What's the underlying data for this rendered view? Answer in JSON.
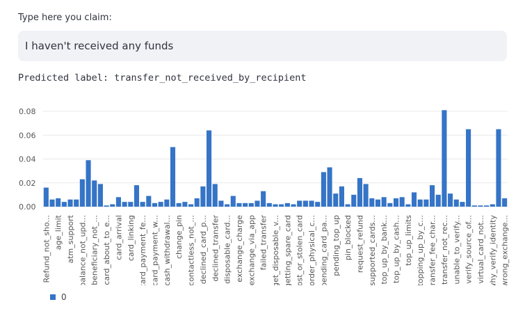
{
  "claim": {
    "label": "Type here you claim:",
    "value": "I haven't received any funds"
  },
  "prediction": {
    "text": "Predicted label: transfer_not_received_by_recipient"
  },
  "colors": {
    "bar": "#3574c6",
    "input_bg": "#f0f2f6",
    "grid": "#e8e8e8"
  },
  "chart_data": {
    "type": "bar",
    "ylim": [
      0,
      0.082
    ],
    "yticks": [
      "0.00",
      "0.02",
      "0.04",
      "0.06",
      "0.08"
    ],
    "ytick_values": [
      0,
      0.02,
      0.04,
      0.06,
      0.08
    ],
    "tick_labels": [
      "Refund_not_sho...",
      "age_limit",
      "atm_support",
      "balance_not_upd...",
      "beneficiary_not_...",
      "card_about_to_e...",
      "card_arrival",
      "card_linking",
      "card_payment_fe...",
      "card_payment_w...",
      "cash_withdrawal...",
      "change_pin",
      "contactless_not_...",
      "declined_card_p...",
      "declined_transfer",
      "disposable_card...",
      "exchange_charge",
      "exchange_via_app",
      "failed_transfer",
      "get_disposable_v...",
      "getting_spare_card",
      "lost_or_stolen_card",
      "order_physical_c...",
      "pending_card_pa...",
      "pending_top_up",
      "pin_blocked",
      "request_refund",
      "supported_cards...",
      "top_up_by_bank...",
      "top_up_by_cash...",
      "top_up_limits",
      "topping_up_by_c...",
      "transfer_fee_char...",
      "transfer_not_rec...",
      "unable_to_verify...",
      "verify_source_of...",
      "virtual_card_not...",
      "why_verify_identity",
      "wrong_exchange..."
    ],
    "values": [
      0.016,
      0.006,
      0.007,
      0.004,
      0.006,
      0.006,
      0.023,
      0.039,
      0.022,
      0.019,
      0.001,
      0.002,
      0.008,
      0.004,
      0.004,
      0.018,
      0.004,
      0.009,
      0.003,
      0.004,
      0.006,
      0.05,
      0.003,
      0.004,
      0.002,
      0.007,
      0.017,
      0.064,
      0.019,
      0.005,
      0.002,
      0.009,
      0.003,
      0.003,
      0.003,
      0.005,
      0.013,
      0.003,
      0.002,
      0.002,
      0.003,
      0.002,
      0.005,
      0.005,
      0.005,
      0.004,
      0.029,
      0.033,
      0.011,
      0.017,
      0.002,
      0.01,
      0.024,
      0.019,
      0.007,
      0.006,
      0.008,
      0.003,
      0.007,
      0.008,
      0.002,
      0.012,
      0.006,
      0.006,
      0.018,
      0.01,
      0.081,
      0.011,
      0.006,
      0.004,
      0.065,
      0.001,
      0.001,
      0.001,
      0.002,
      0.065,
      0.007
    ],
    "legend": [
      "0"
    ],
    "legend_position": "bottom-left",
    "grid": true
  }
}
